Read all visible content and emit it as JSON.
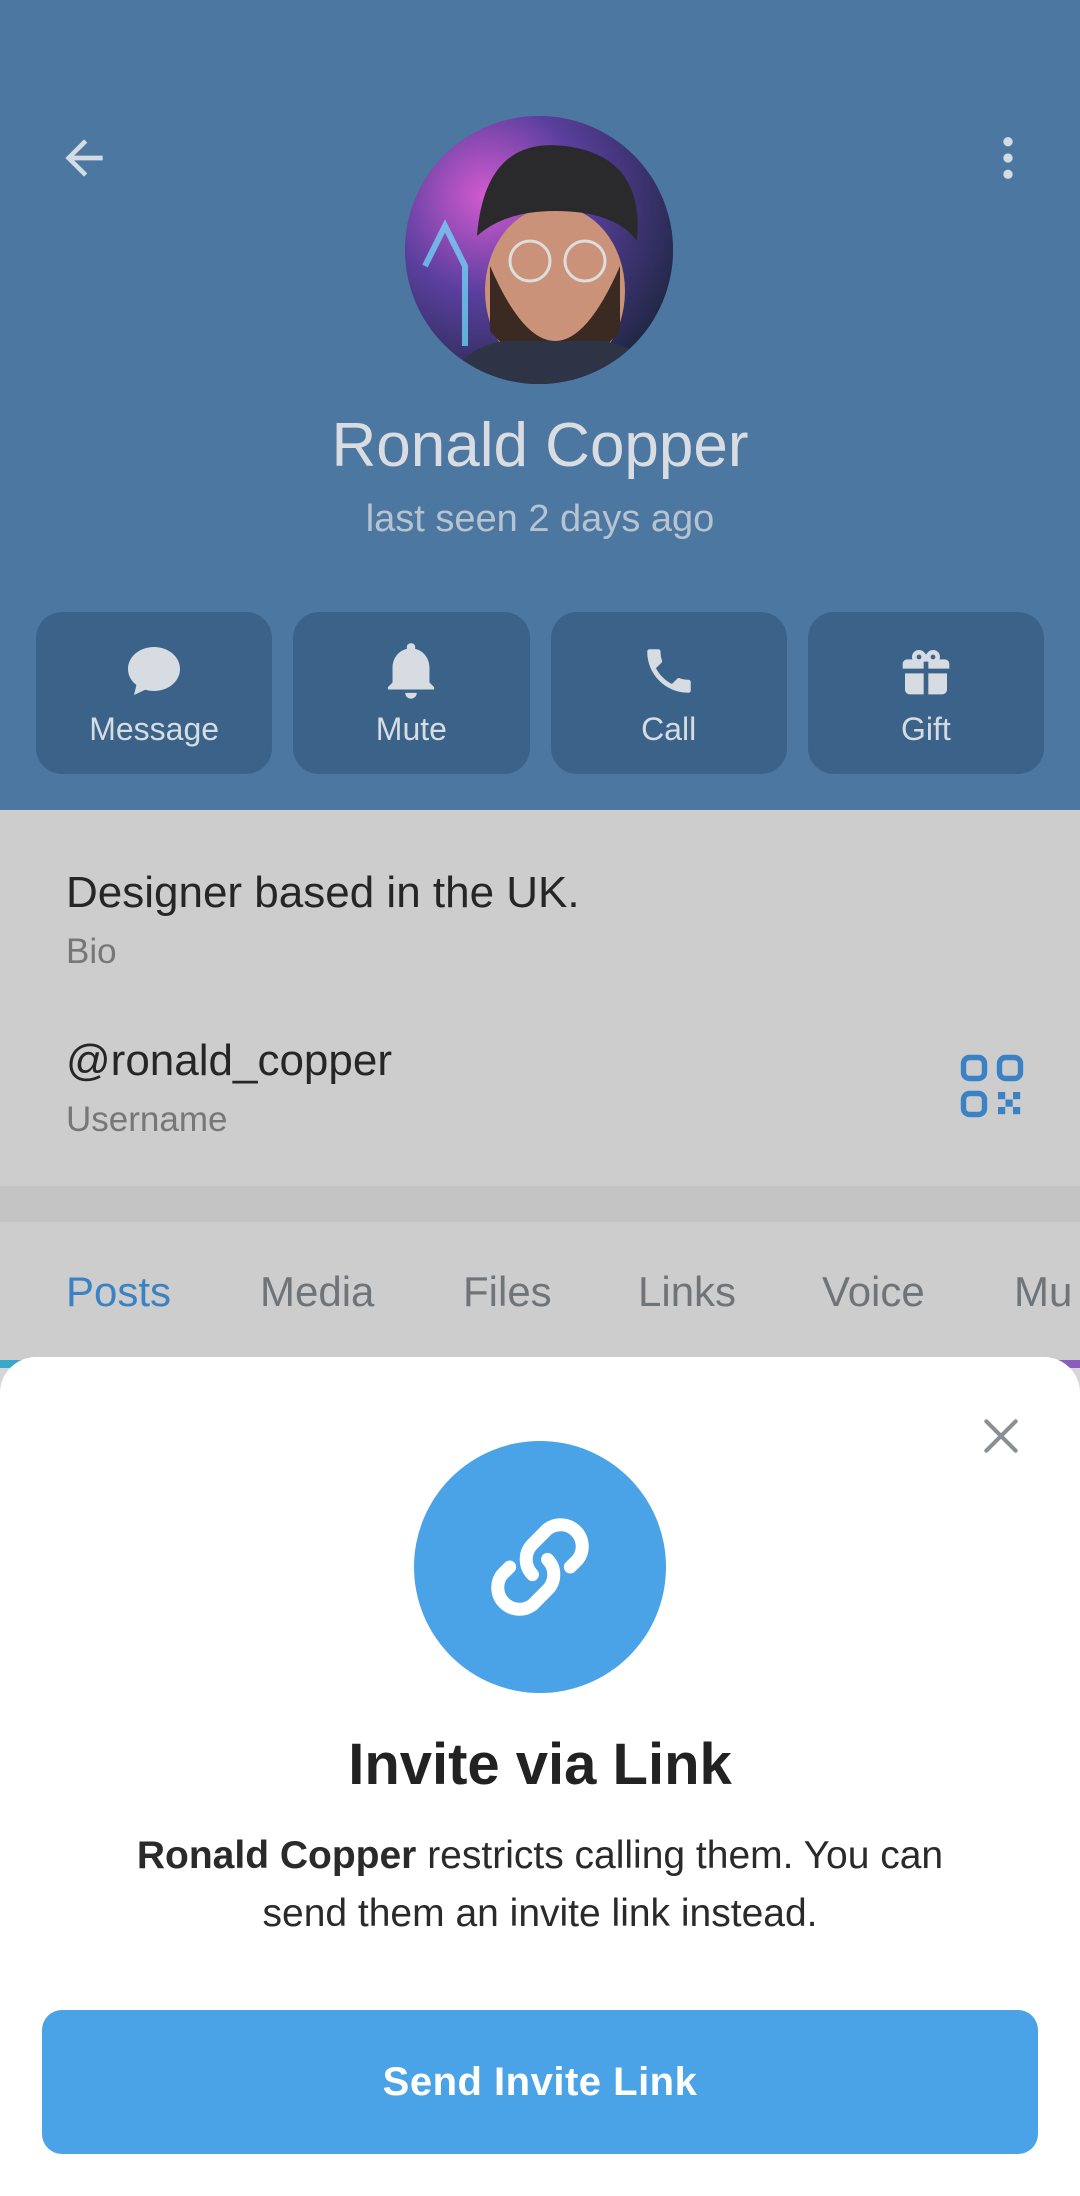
{
  "header": {
    "name": "Ronald Copper",
    "status": "last seen 2 days ago"
  },
  "actions": [
    {
      "label": "Message",
      "icon": "chat-bubble-icon"
    },
    {
      "label": "Mute",
      "icon": "bell-icon"
    },
    {
      "label": "Call",
      "icon": "phone-icon"
    },
    {
      "label": "Gift",
      "icon": "gift-icon"
    }
  ],
  "info": {
    "bio": "Designer based in the UK.",
    "bio_label": "Bio",
    "username": "@ronald_copper",
    "username_label": "Username"
  },
  "tabs": [
    {
      "label": "Posts",
      "active": true
    },
    {
      "label": "Media",
      "active": false
    },
    {
      "label": "Files",
      "active": false
    },
    {
      "label": "Links",
      "active": false
    },
    {
      "label": "Voice",
      "active": false
    },
    {
      "label": "Mu",
      "active": false
    }
  ],
  "sheet": {
    "title": "Invite via Link",
    "desc_name": "Ronald Copper",
    "desc_rest": " restricts calling them. You can send them an invite link instead.",
    "button_label": "Send Invite Link"
  },
  "colors": {
    "header_bg": "#4c77a0",
    "action_bg": "#3b6389",
    "accent_blue": "#4aa3e6",
    "tab_active": "#3a82c4"
  }
}
